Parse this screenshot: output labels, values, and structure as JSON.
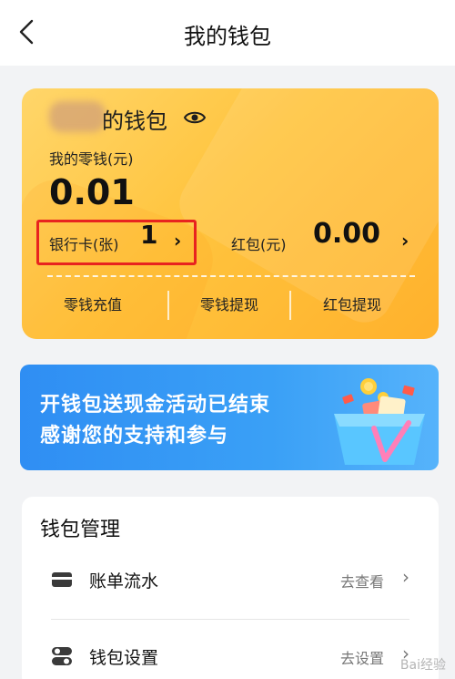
{
  "header": {
    "title": "我的钱包"
  },
  "wallet": {
    "name_suffix": "的钱包",
    "change_label": "我的零钱(元)",
    "change_value": "0.01",
    "bank_card_label": "银行卡(张)",
    "bank_card_value": "1",
    "red_packet_label": "红包(元)",
    "red_packet_value": "0.00",
    "actions": [
      "零钱充值",
      "零钱提现",
      "红包提现"
    ],
    "chevron": "›"
  },
  "banner": {
    "line1": "开钱包送现金活动已结束",
    "line2": "感谢您的支持和参与"
  },
  "manage": {
    "title": "钱包管理",
    "rows": [
      {
        "label": "账单流水",
        "action": "去查看",
        "icon": "bill-icon"
      },
      {
        "label": "钱包设置",
        "action": "去设置",
        "icon": "settings-toggle-icon"
      }
    ]
  },
  "watermark": "Bai经验"
}
